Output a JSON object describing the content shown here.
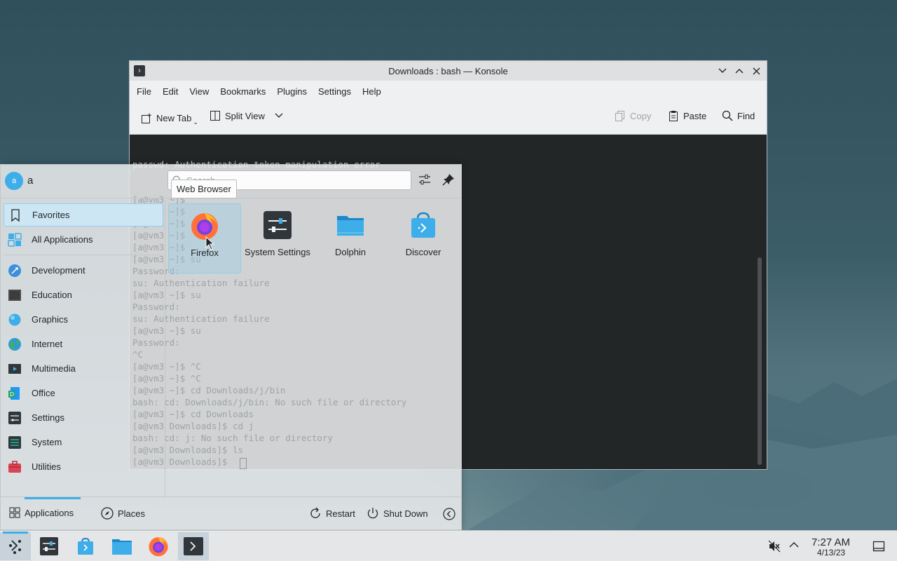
{
  "konsole": {
    "title": "Downloads : bash — Konsole",
    "menu": [
      "File",
      "Edit",
      "View",
      "Bookmarks",
      "Plugins",
      "Settings",
      "Help"
    ],
    "toolbar": {
      "new_tab": "New Tab",
      "split_view": "Split View",
      "copy": "Copy",
      "paste": "Paste",
      "find": "Find"
    },
    "terminal_lines": [
      "passwd: Authentication token manipulation error",
      "[a@vm3 ~]$",
      "[a@vm3 ~]$",
      "[a@vm3 ~]$",
      "[a@vm3 ~]$",
      "[a@vm3 ~]$",
      "[a@vm3 ~]$ su",
      "Password:",
      "su: Authentication failure",
      "[a@vm3 ~]$ su",
      "Password:",
      "su: Authentication failure",
      "[a@vm3 ~]$ su",
      "Password:",
      "^C",
      "[a@vm3 ~]$ ^C",
      "[a@vm3 ~]$ ^C",
      "[a@vm3 ~]$ cd Downloads/j/bin",
      "bash: cd: Downloads/j/bin: No such file or directory",
      "[a@vm3 ~]$ cd Downloads",
      "[a@vm3 Downloads]$ cd j",
      "bash: cd: j: No such file or directory",
      "[a@vm3 Downloads]$ ls",
      "[a@vm3 Downloads]$ "
    ]
  },
  "launcher": {
    "user_initial": "a",
    "username": "a",
    "search_placeholder": "Search",
    "tooltip": "Web Browser",
    "categories": [
      {
        "label": "Favorites",
        "icon": "bookmark-icon"
      },
      {
        "label": "All Applications",
        "icon": "grid-icon"
      },
      {
        "label": "Development",
        "icon": "development-icon"
      },
      {
        "label": "Education",
        "icon": "education-icon"
      },
      {
        "label": "Graphics",
        "icon": "graphics-icon"
      },
      {
        "label": "Internet",
        "icon": "internet-icon"
      },
      {
        "label": "Multimedia",
        "icon": "multimedia-icon"
      },
      {
        "label": "Office",
        "icon": "office-icon"
      },
      {
        "label": "Settings",
        "icon": "settings-icon"
      },
      {
        "label": "System",
        "icon": "system-icon"
      },
      {
        "label": "Utilities",
        "icon": "utilities-icon"
      }
    ],
    "favorites": [
      {
        "label": "Firefox",
        "icon": "firefox-icon"
      },
      {
        "label": "System Settings",
        "icon": "system-settings-icon"
      },
      {
        "label": "Dolphin",
        "icon": "dolphin-icon"
      },
      {
        "label": "Discover",
        "icon": "discover-icon"
      }
    ],
    "footer": {
      "applications": "Applications",
      "places": "Places",
      "restart": "Restart",
      "shutdown": "Shut Down"
    }
  },
  "taskbar": {
    "time": "7:27 AM",
    "date": "4/13/23"
  }
}
